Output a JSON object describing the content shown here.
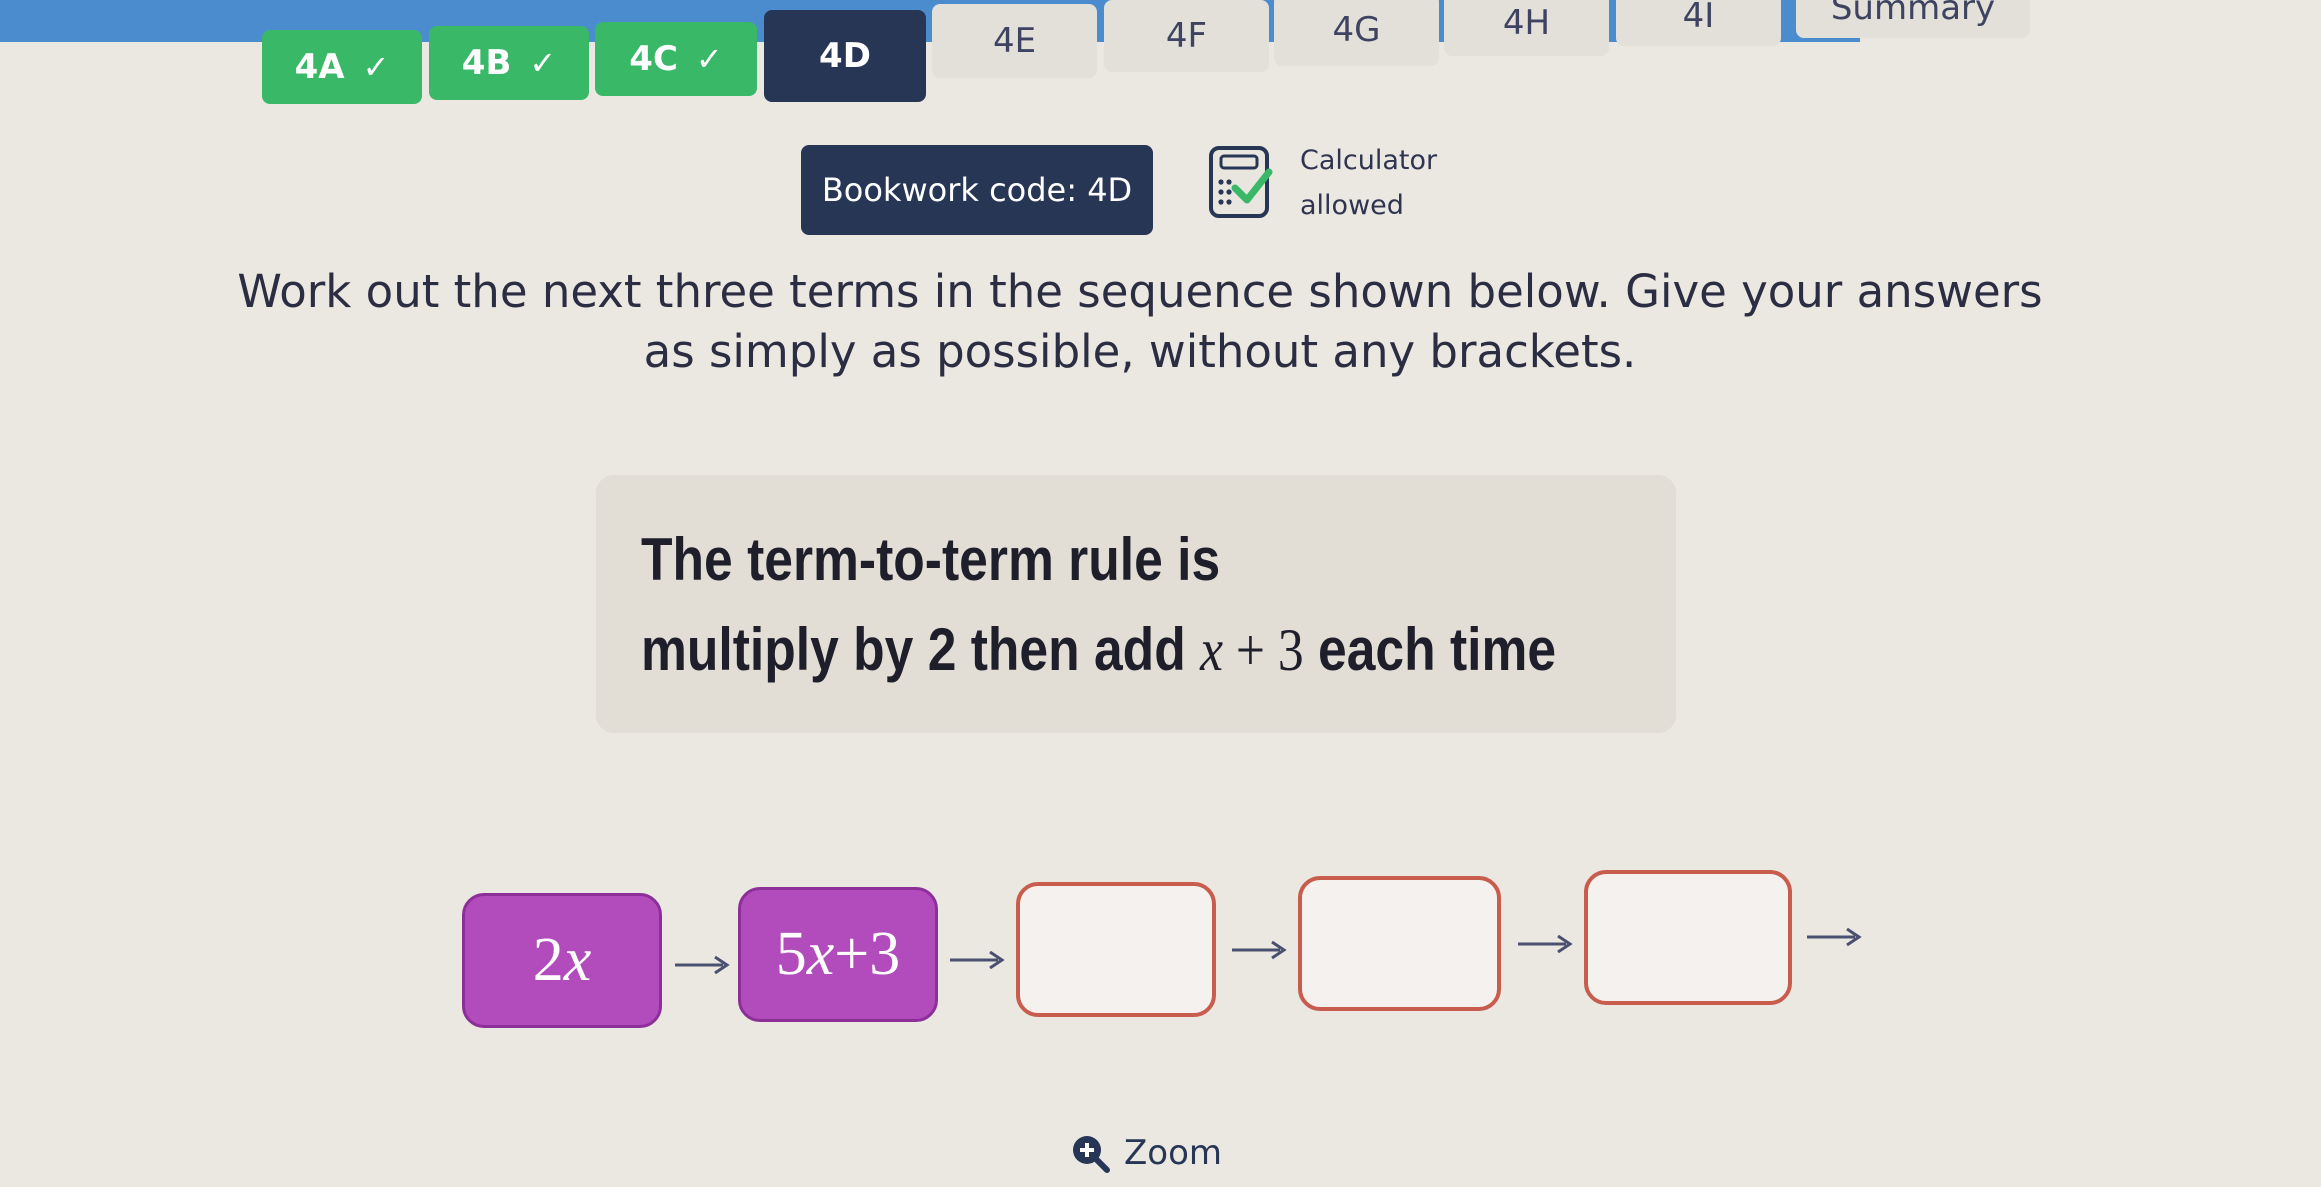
{
  "tabs": [
    {
      "label": "4A",
      "state": "done",
      "check": "✓"
    },
    {
      "label": "4B",
      "state": "done",
      "check": "✓"
    },
    {
      "label": "4C",
      "state": "done",
      "check": "✓"
    },
    {
      "label": "4D",
      "state": "current"
    },
    {
      "label": "4E",
      "state": "todo"
    },
    {
      "label": "4F",
      "state": "todo"
    },
    {
      "label": "4G",
      "state": "todo"
    },
    {
      "label": "4H",
      "state": "todo"
    },
    {
      "label": "4I",
      "state": "todo"
    },
    {
      "label": "Summary",
      "state": "todo"
    }
  ],
  "bookwork": {
    "label": "Bookwork code: 4D"
  },
  "calculator": {
    "line1": "Calculator",
    "line2": "allowed",
    "icon": "calculator-icon",
    "status_color": "#39b868"
  },
  "question": {
    "line1": "Work out the next three terms in the sequence shown below. Give your answers",
    "line2": "as simply as possible, without any brackets."
  },
  "rule": {
    "line1": "The term-to-term rule is",
    "line2_pre": "multiply by 2 then add ",
    "var": "x",
    "op": " + ",
    "num": "3",
    "line2_post": " each time"
  },
  "sequence": {
    "term1": {
      "coef": "2",
      "var": "x"
    },
    "term2": {
      "coef": "5",
      "var": "x",
      "rest": "+3"
    },
    "answers": [
      "",
      "",
      ""
    ]
  },
  "zoom": {
    "label": "Zoom",
    "icon": "zoom-in-icon"
  },
  "colors": {
    "done_tab": "#39b868",
    "current_tab": "#283656",
    "term_fill": "#b24cbc",
    "answer_border": "#c95d4d"
  }
}
